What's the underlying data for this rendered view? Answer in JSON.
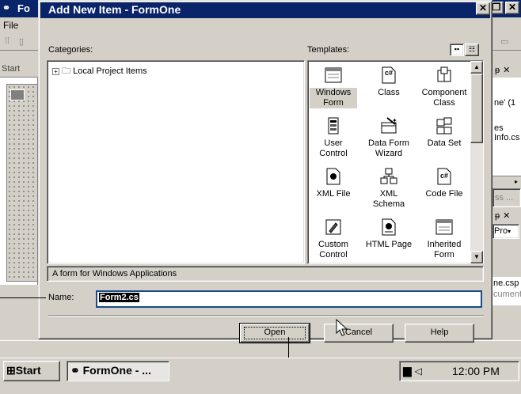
{
  "ide": {
    "title": "Fo",
    "menu_file": "File",
    "start_tab": "Start",
    "solution_lines": [
      "ne' (1",
      "es",
      "Info.cs"
    ],
    "solution_tab": "ss ...",
    "props_combo": "Pro",
    "props_file_lines": [
      "ne.csp",
      "cument"
    ]
  },
  "dialog": {
    "title": "Add New Item - FormOne",
    "categories_label": "Categories:",
    "templates_label": "Templates:",
    "category_item": "Local Project Items",
    "templates": [
      {
        "label": "Windows Form",
        "icon": "windows-form-icon",
        "selected": true
      },
      {
        "label": "Class",
        "icon": "class-icon"
      },
      {
        "label": "Component Class",
        "icon": "component-class-icon"
      },
      {
        "label": "User Control",
        "icon": "user-control-icon"
      },
      {
        "label": "Data Form Wizard",
        "icon": "data-form-wizard-icon"
      },
      {
        "label": "Data Set",
        "icon": "data-set-icon"
      },
      {
        "label": "XML File",
        "icon": "xml-file-icon"
      },
      {
        "label": "XML Schema",
        "icon": "xml-schema-icon"
      },
      {
        "label": "Code File",
        "icon": "code-file-icon"
      },
      {
        "label": "Custom Control",
        "icon": "custom-control-icon"
      },
      {
        "label": "HTML Page",
        "icon": "html-page-icon"
      },
      {
        "label": "Inherited Form",
        "icon": "inherited-form-icon"
      }
    ],
    "description": "A form for Windows Applications",
    "name_label": "Name:",
    "name_value": "Form2.cs",
    "buttons": {
      "open": "Open",
      "cancel": "Cancel",
      "help": "Help"
    }
  },
  "taskbar": {
    "start": "Start",
    "task": "FormOne - ...",
    "time": "12:00 PM"
  },
  "colors": {
    "titlebar": "#0a246a",
    "face": "#d4d0c8"
  }
}
